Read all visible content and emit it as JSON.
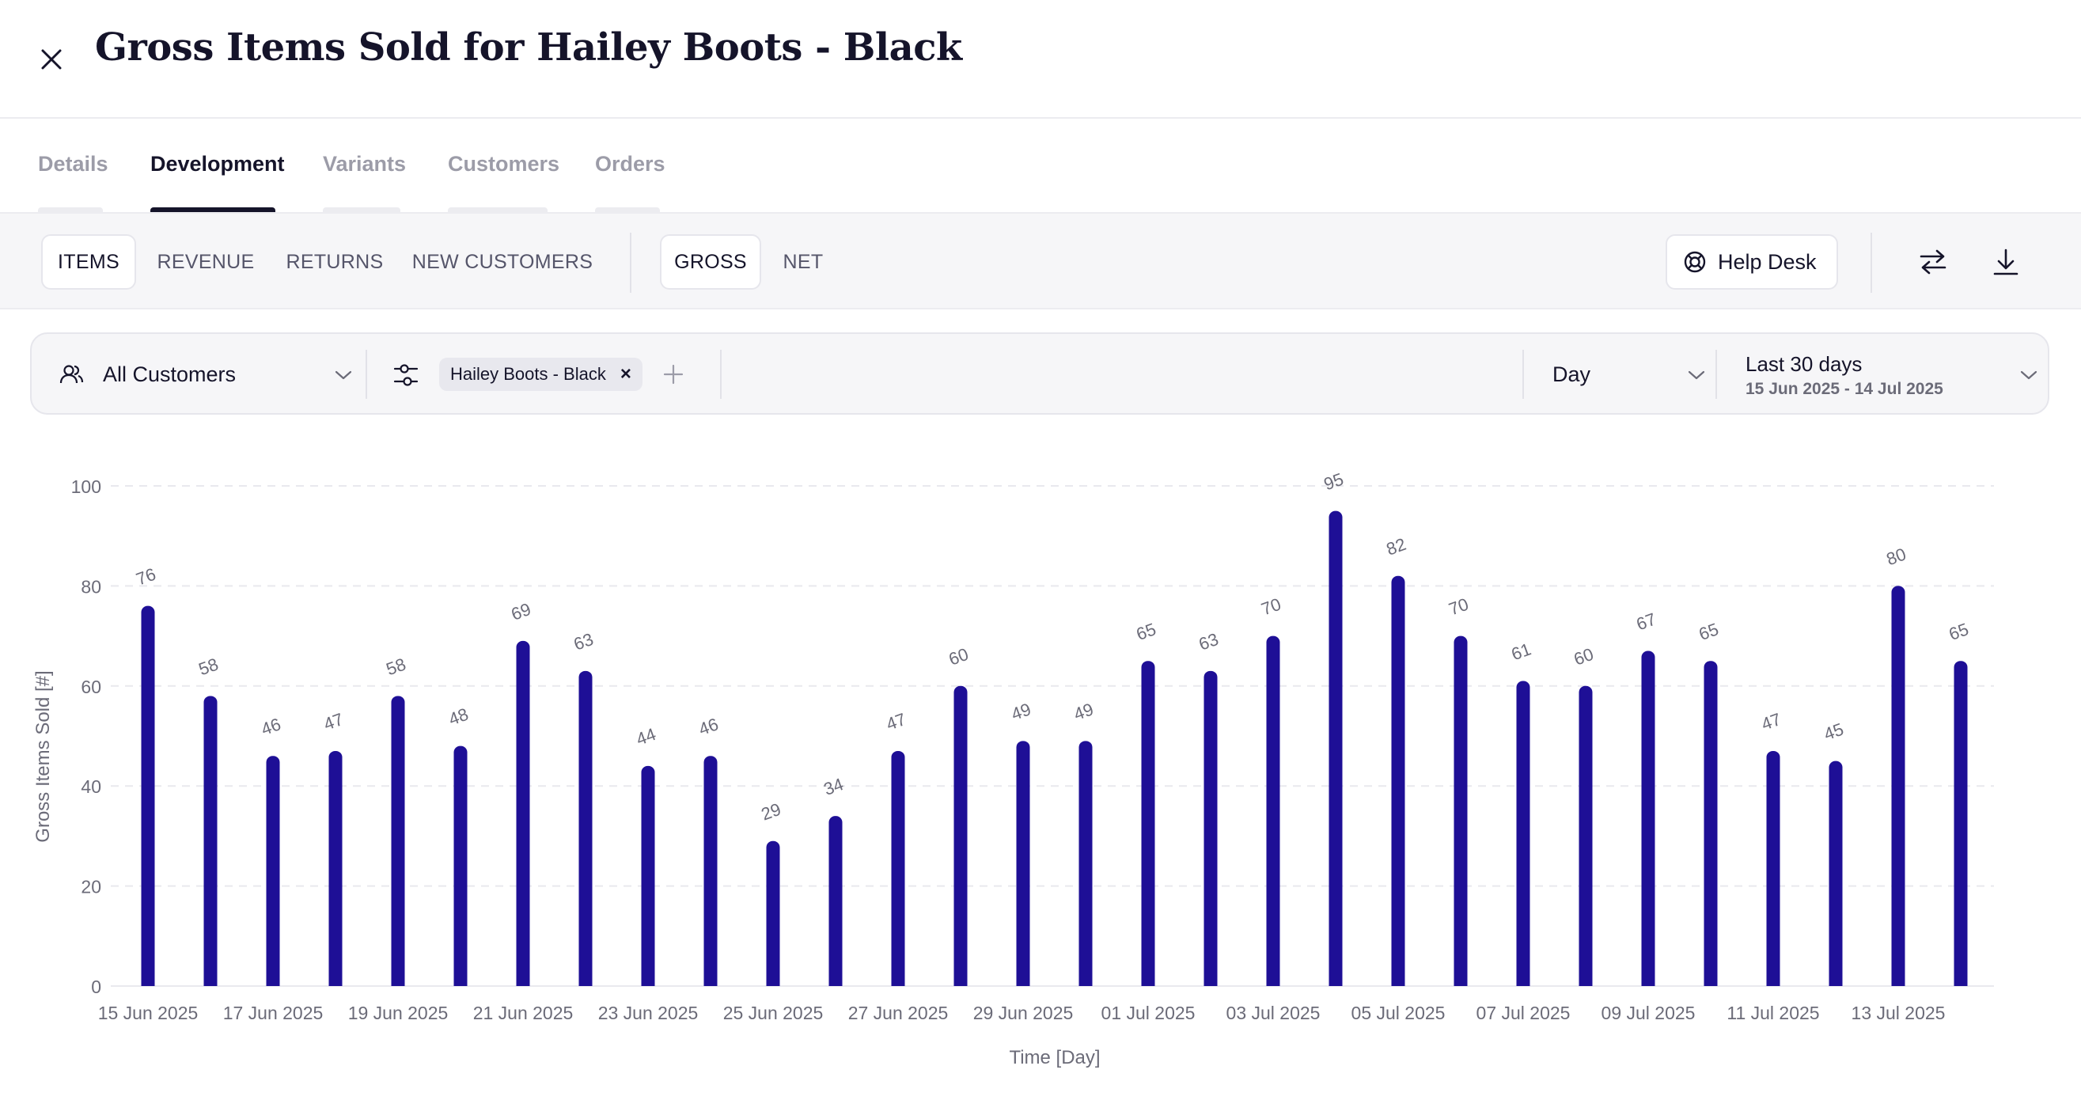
{
  "header": {
    "title": "Gross Items Sold for Hailey Boots - Black",
    "close_icon": "close-icon"
  },
  "tabs": [
    {
      "label": "Details",
      "active": false
    },
    {
      "label": "Development",
      "active": true
    },
    {
      "label": "Variants",
      "active": false
    },
    {
      "label": "Customers",
      "active": false
    },
    {
      "label": "Orders",
      "active": false
    }
  ],
  "toolbar": {
    "metrics": [
      {
        "label": "ITEMS",
        "active": true
      },
      {
        "label": "REVENUE",
        "active": false
      },
      {
        "label": "RETURNS",
        "active": false
      },
      {
        "label": "NEW CUSTOMERS",
        "active": false
      }
    ],
    "mode": [
      {
        "label": "GROSS",
        "active": true
      },
      {
        "label": "NET",
        "active": false
      }
    ],
    "help_desk_label": "Help Desk",
    "help_icon": "lifebuoy-icon",
    "compare_icon": "swap-arrows-icon",
    "download_icon": "download-icon"
  },
  "filters": {
    "customer_segment": "All Customers",
    "product_chip": "Hailey Boots - Black",
    "granularity": "Day",
    "range_label": "Last 30 days",
    "range_dates": "15 Jun 2025 - 14 Jul 2025"
  },
  "colors": {
    "bar": "#1e0f96",
    "grid": "#e9e9ee",
    "axis_text": "#6b6b78"
  },
  "chart_data": {
    "type": "bar",
    "ylabel": "Gross Items Sold [#]",
    "xlabel": "Time [Day]",
    "ylim": [
      0,
      100
    ],
    "yticks": [
      0,
      20,
      40,
      60,
      80,
      100
    ],
    "grid": true,
    "categories": [
      "15 Jun 2025",
      "16 Jun 2025",
      "17 Jun 2025",
      "18 Jun 2025",
      "19 Jun 2025",
      "20 Jun 2025",
      "21 Jun 2025",
      "22 Jun 2025",
      "23 Jun 2025",
      "24 Jun 2025",
      "25 Jun 2025",
      "26 Jun 2025",
      "27 Jun 2025",
      "28 Jun 2025",
      "29 Jun 2025",
      "30 Jun 2025",
      "01 Jul 2025",
      "02 Jul 2025",
      "03 Jul 2025",
      "04 Jul 2025",
      "05 Jul 2025",
      "06 Jul 2025",
      "07 Jul 2025",
      "08 Jul 2025",
      "09 Jul 2025",
      "10 Jul 2025",
      "11 Jul 2025",
      "12 Jul 2025",
      "13 Jul 2025",
      "14 Jul 2025"
    ],
    "values": [
      76,
      58,
      46,
      47,
      58,
      48,
      69,
      63,
      44,
      46,
      29,
      34,
      47,
      60,
      49,
      49,
      65,
      63,
      70,
      95,
      82,
      70,
      61,
      60,
      67,
      65,
      47,
      45,
      80,
      65
    ],
    "xtick_labels": [
      "15 Jun 2025",
      "17 Jun 2025",
      "19 Jun 2025",
      "21 Jun 2025",
      "23 Jun 2025",
      "25 Jun 2025",
      "27 Jun 2025",
      "29 Jun 2025",
      "01 Jul 2025",
      "03 Jul 2025",
      "05 Jul 2025",
      "07 Jul 2025",
      "09 Jul 2025",
      "11 Jul 2025",
      "13 Jul 2025"
    ]
  }
}
